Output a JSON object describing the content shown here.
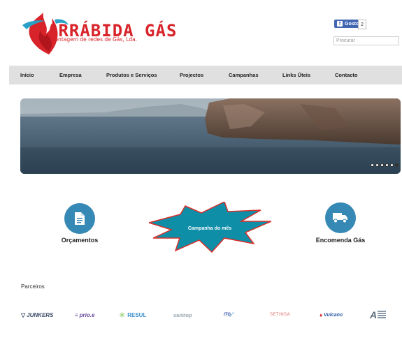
{
  "header": {
    "logo_title": "ARRÁBIDA GÁS",
    "logo_subtitle": "Montagem de redes de Gás, Lda.",
    "facebook_like_label": "Gosto",
    "facebook_like_count": "2",
    "search_placeholder": "Procurar"
  },
  "nav": {
    "items": [
      {
        "label": "Início"
      },
      {
        "label": "Empresa"
      },
      {
        "label": "Produtos e Serviços"
      },
      {
        "label": "Projectos"
      },
      {
        "label": "Campanhas"
      },
      {
        "label": "Links Úteis"
      },
      {
        "label": "Contacto"
      }
    ]
  },
  "slider": {
    "slide_count": 6,
    "active_index": 5
  },
  "features": {
    "orcamentos_label": "Orçamentos",
    "campanha_label": "Campanha do mês",
    "encomenda_label": "Encomenda Gás"
  },
  "partners": {
    "title": "Parceiros",
    "items": [
      {
        "name": "JUNKERS",
        "color": "#3a4a66"
      },
      {
        "name": "prio.e",
        "color": "#6a4ca0"
      },
      {
        "name": "RESUL",
        "color": "#3a8fd0"
      },
      {
        "name": "sanitop",
        "color": "#9aa8b2"
      },
      {
        "name": "ITG",
        "color": "#2a4aa0"
      },
      {
        "name": "SETINSA",
        "color": "#e06a6a"
      },
      {
        "name": "Vulcano",
        "color": "#2a5aa8"
      },
      {
        "name": "A",
        "color": "#5a6a7a"
      }
    ]
  },
  "colors": {
    "brand_red": "#d8232a",
    "nav_bg": "#e0e0e0",
    "feature_blue": "#3789b5",
    "burst_fill": "#0f8ea8",
    "burst_stroke": "#d9302a"
  }
}
